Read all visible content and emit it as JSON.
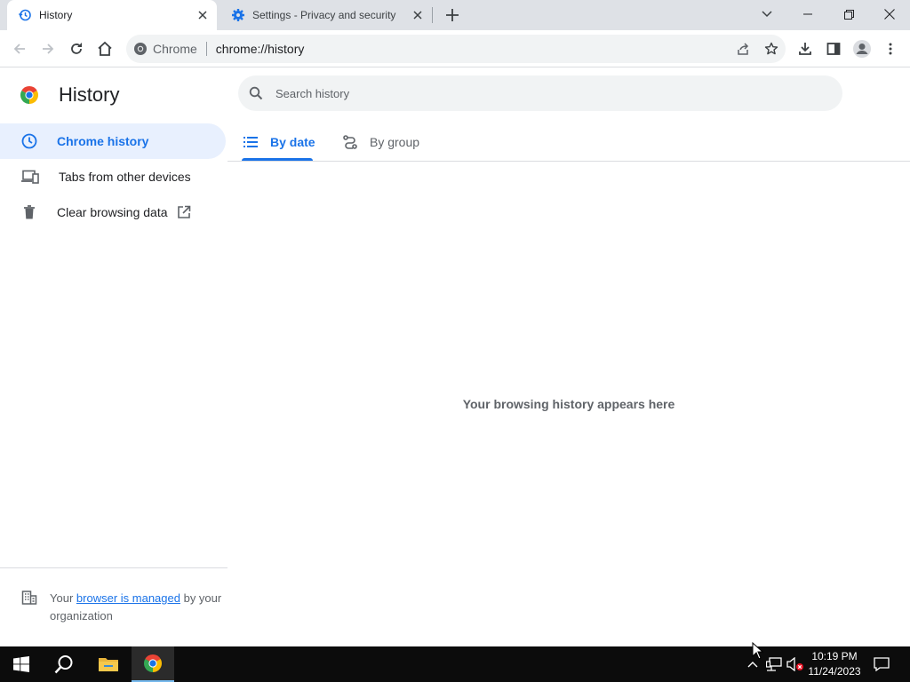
{
  "browser": {
    "tabs": [
      {
        "title": "History",
        "active": true
      },
      {
        "title": "Settings - Privacy and security",
        "active": false
      }
    ],
    "omnibox": {
      "site_chip": "Chrome",
      "url": "chrome://history"
    }
  },
  "page": {
    "title": "History",
    "search_placeholder": "Search history",
    "sidebar": {
      "items": [
        {
          "label": "Chrome history",
          "icon": "clock-icon",
          "selected": true
        },
        {
          "label": "Tabs from other devices",
          "icon": "devices-icon",
          "selected": false
        },
        {
          "label": "Clear browsing data",
          "icon": "trash-icon",
          "selected": false
        }
      ]
    },
    "view_tabs": [
      {
        "label": "By date",
        "active": true
      },
      {
        "label": "By group",
        "active": false
      }
    ],
    "empty_message": "Your browsing history appears here",
    "managed": {
      "prefix": "Your",
      "link": "browser is managed",
      "suffix": "by your organization"
    }
  },
  "taskbar": {
    "time": "10:19 PM",
    "date": "11/24/2023"
  },
  "colors": {
    "accent": "#1a73e8",
    "selected_bg": "#e8f0fe",
    "tabstrip": "#dee1e6",
    "taskbar": "#0c0c0c"
  }
}
